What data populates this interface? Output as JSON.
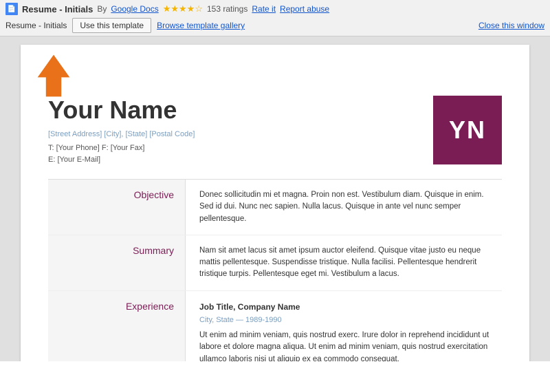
{
  "topbar": {
    "doc_icon_label": "D",
    "title": "Resume - Initials",
    "by_label": "By",
    "author": "Google Docs",
    "ratings_stars": "★★★★☆",
    "ratings_count": "153 ratings",
    "rate_label": "Rate it",
    "report_label": "Report abuse",
    "doc_subtitle": "Resume - Initials",
    "use_template_label": "Use this template",
    "browse_gallery_label": "Browse template gallery",
    "close_window_label": "Close this window"
  },
  "resume": {
    "your_name": "Your Name",
    "address": "[Street Address] [City], [State] [Postal Code]",
    "phone_line": "T: [Your Phone]  F: [Your Fax]",
    "email_line": "E: [Your E-Mail]",
    "initials": "YN",
    "sections": [
      {
        "label": "Objective",
        "content": "Donec sollicitudin mi et magna. Proin non est. Vestibulum diam. Quisque in enim. Sed id dui. Nunc nec sapien. Nulla lacus. Quisque in ante vel nunc semper pellentesque.",
        "type": "text"
      },
      {
        "label": "Summary",
        "content": "Nam sit amet lacus sit amet ipsum auctor eleifend. Quisque vitae justo eu neque mattis pellentesque. Suspendisse tristique. Nulla facilisi. Pellentesque hendrerit tristique turpis. Pellentesque eget mi. Vestibulum a lacus.",
        "type": "text"
      },
      {
        "label": "Experience",
        "job_title": "Job Title, Company Name",
        "job_subtitle": "City, State — 1989-1990",
        "content": "Ut enim ad minim veniam, quis nostrud exerc. Irure dolor in reprehend incididunt ut labore et dolore magna aliqua. Ut enim ad minim veniam, quis nostrud exercitation ullamco laboris nisi ut aliquip ex ea commodo consequat.",
        "type": "experience"
      }
    ]
  }
}
